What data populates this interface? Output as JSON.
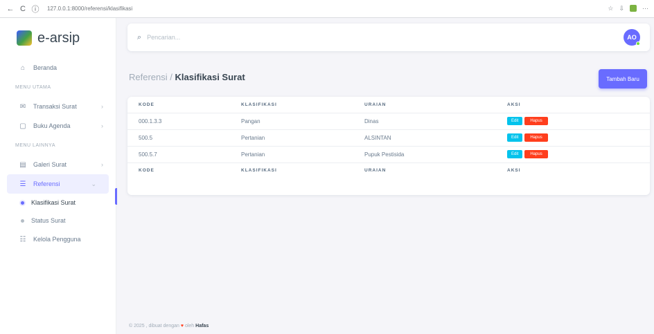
{
  "browser": {
    "back": "←",
    "reload": "C",
    "url": "127.0.0.1:8000/referensi/klasifikasi",
    "controls": [
      "☆",
      "⇩",
      "⋯"
    ]
  },
  "brand": {
    "name": "e-arsip",
    "logo_icon": "app-logo"
  },
  "sidebar": {
    "beranda": "Beranda",
    "header_transaksi": "MENU UTAMA",
    "transaksi": "Transaksi Surat",
    "buku_agenda": "Buku Agenda",
    "header_lainnya": "MENU LAINNYA",
    "galeri": "Galeri Surat",
    "referensi": "Referensi",
    "klasifikasi": "Klasifikasi Surat",
    "status": "Status Surat",
    "kelola": "Kelola Pengguna"
  },
  "navbar": {
    "search_placeholder": "Pencarian...",
    "avatar_initials": "AO"
  },
  "page": {
    "breadcrumb": "Referensi /",
    "title": "Klasifikasi Surat",
    "add_button": "Tambah Baru"
  },
  "table": {
    "headers": [
      "KODE",
      "KLASIFIKASI",
      "URAIAN",
      "AKSI"
    ],
    "rows": [
      {
        "kode": "000.1.3.3",
        "klasifikasi": "Pangan",
        "uraian": "Dinas",
        "edit": "Edit",
        "hapus": "Hapus"
      },
      {
        "kode": "500.5",
        "klasifikasi": "Pertanian",
        "uraian": "ALSINTAN",
        "edit": "Edit",
        "hapus": "Hapus"
      },
      {
        "kode": "500.5.7",
        "klasifikasi": "Pertanian",
        "uraian": "Pupuk Pestisida",
        "edit": "Edit",
        "hapus": "Hapus"
      }
    ]
  },
  "footer": {
    "prefix": "© 2025 , dibuat dengan",
    "heart": "♥",
    "by": "oleh",
    "author": "Hafas"
  },
  "colors": {
    "primary": "#696cff",
    "info": "#03c3ec",
    "danger": "#ff3e1d"
  }
}
